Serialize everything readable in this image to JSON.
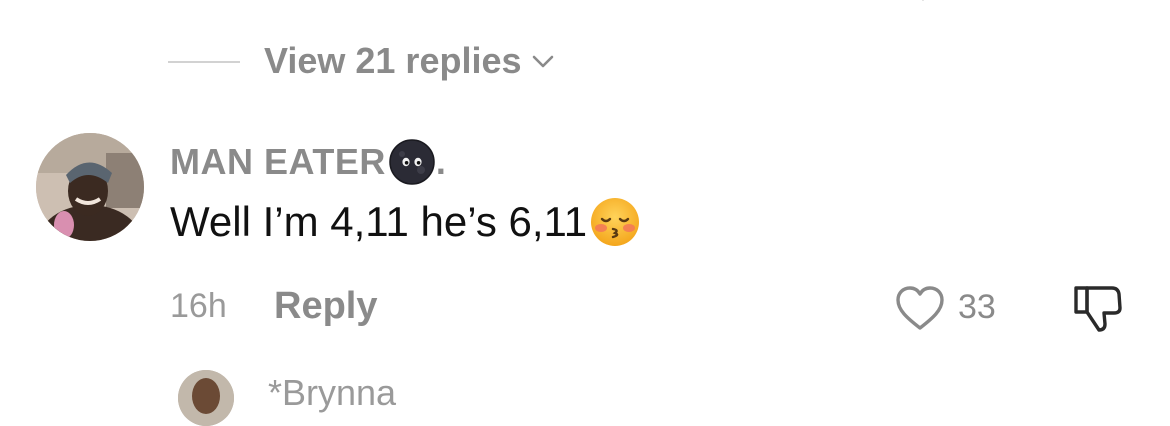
{
  "thread": {
    "view_replies_label": "View 21 replies"
  },
  "comment": {
    "username": "MAN EATER",
    "username_suffix": ".",
    "text": "Well I’m 4,11 he’s 6,11",
    "time": "16h",
    "reply_label": "Reply",
    "like_count": "33"
  },
  "next_comment": {
    "username_partial": "*Brynna"
  },
  "icons": {
    "chevron": "chevron-down-icon",
    "moon": "new-moon-face-emoji",
    "kiss": "kissing-face-with-closed-eyes-emoji",
    "like": "heart-outline-icon",
    "dislike": "thumbs-down-outline-icon"
  },
  "colors": {
    "text_primary": "#111111",
    "text_secondary": "#8a8a8a",
    "divider": "#d2d2d2",
    "background": "#ffffff"
  }
}
